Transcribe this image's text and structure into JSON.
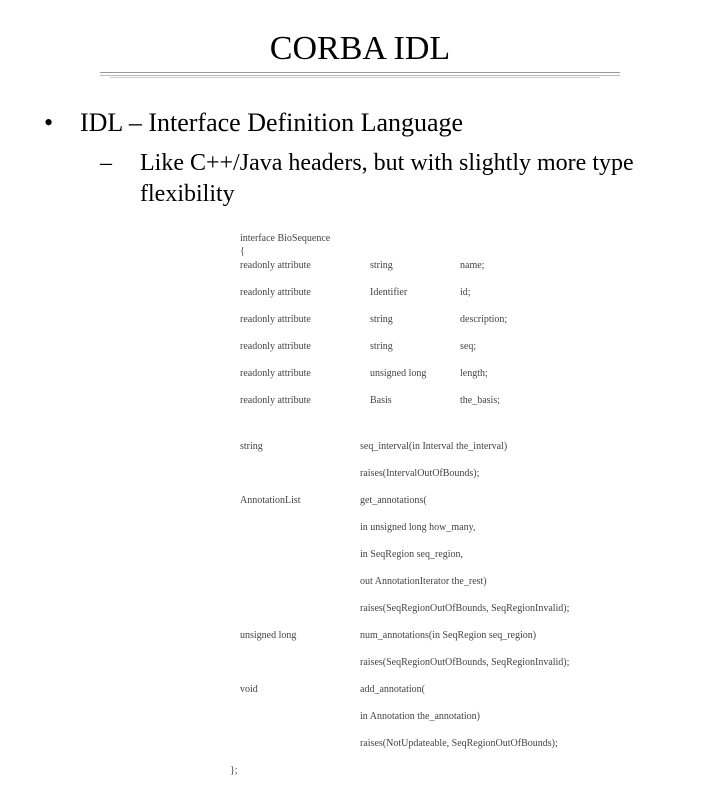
{
  "title": "CORBA IDL",
  "bullets": {
    "l1": "IDL – Interface Definition Language",
    "l2": "Like C++/Java headers, but with slightly more type flexibility"
  },
  "code": {
    "open1": "interface BioSequence",
    "open2": "{",
    "attrs": [
      {
        "kw": "readonly attribute",
        "type": "string",
        "name": "name;"
      },
      {
        "kw": "readonly attribute",
        "type": "Identifier",
        "name": "id;"
      },
      {
        "kw": "readonly attribute",
        "type": "string",
        "name": "description;"
      },
      {
        "kw": "readonly attribute",
        "type": "string",
        "name": "seq;"
      },
      {
        "kw": "readonly attribute",
        "type": "unsigned long",
        "name": "length;"
      },
      {
        "kw": "readonly attribute",
        "type": "Basis",
        "name": "the_basis;"
      }
    ],
    "m1_ret": "string",
    "m1_sig": "seq_interval(in Interval the_interval)",
    "m1_raises": "raises(IntervalOutOfBounds);",
    "m2_ret": "AnnotationList",
    "m2_sig": "get_annotations(",
    "m2_p1": "in unsigned long how_many,",
    "m2_p2": "in SeqRegion seq_region,",
    "m2_p3": "out AnnotationIterator the_rest)",
    "m2_raises": "raises(SeqRegionOutOfBounds, SeqRegionInvalid);",
    "m3_ret": "unsigned long",
    "m3_sig": "num_annotations(in SeqRegion seq_region)",
    "m3_raises": "raises(SeqRegionOutOfBounds, SeqRegionInvalid);",
    "m4_ret": "void",
    "m4_sig": "add_annotation(",
    "m4_p1": "in Annotation the_annotation)",
    "m4_raises": "raises(NotUpdateable, SeqRegionOutOfBounds);",
    "close": "};"
  }
}
